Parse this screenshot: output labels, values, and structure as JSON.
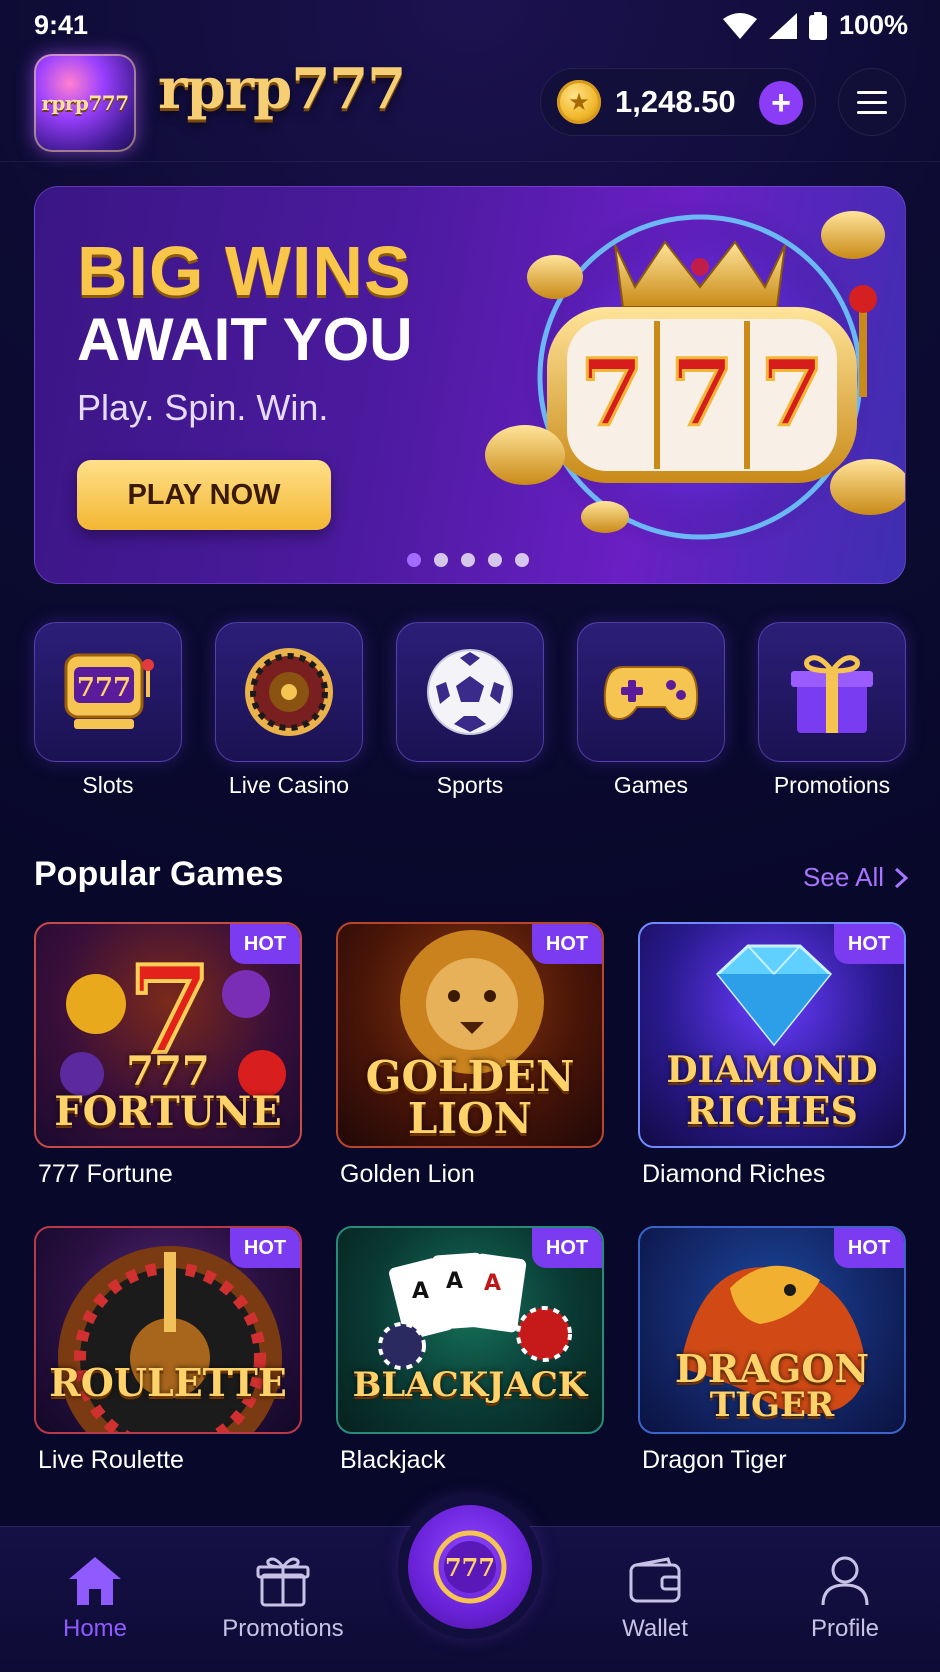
{
  "status_bar": {
    "time": "9:41",
    "battery": "100%"
  },
  "header": {
    "logo_text": "rprp777",
    "brand": "rprp777",
    "balance": "1,248.50",
    "add_label": "+"
  },
  "banner": {
    "title_line1": "BIG WINS",
    "title_line2": "AWAIT YOU",
    "subtitle": "Play. Spin. Win.",
    "cta": "PLAY NOW",
    "slot_digits": "777",
    "active_slide": 1,
    "slide_count": 5
  },
  "categories": [
    {
      "label": "Slots",
      "icon": "slot-machine-icon"
    },
    {
      "label": "Live Casino",
      "icon": "roulette-wheel-icon"
    },
    {
      "label": "Sports",
      "icon": "soccer-ball-icon"
    },
    {
      "label": "Games",
      "icon": "gamepad-icon"
    },
    {
      "label": "Promotions",
      "icon": "gift-icon"
    }
  ],
  "popular": {
    "title": "Popular Games",
    "see_all": "See All",
    "badge": "HOT",
    "games": [
      {
        "name": "777 Fortune",
        "art_line1": "777",
        "art_line2": "FORTUNE"
      },
      {
        "name": "Golden Lion",
        "art_line1": "GOLDEN",
        "art_line2": "LION"
      },
      {
        "name": "Diamond Riches",
        "art_line1": "DIAMOND",
        "art_line2": "RICHES"
      },
      {
        "name": "Live Roulette",
        "art_line1": "ROULETTE",
        "art_line2": ""
      },
      {
        "name": "Blackjack",
        "art_line1": "BLACKJACK",
        "art_line2": ""
      },
      {
        "name": "Dragon Tiger",
        "art_line1": "DRAGON",
        "art_line2": "TIGER"
      }
    ]
  },
  "bottom_nav": {
    "items": [
      {
        "label": "Home",
        "icon": "home-icon",
        "active": true
      },
      {
        "label": "Promotions",
        "icon": "gift-icon"
      },
      {
        "label": "Wallet",
        "icon": "wallet-icon"
      },
      {
        "label": "Profile",
        "icon": "user-icon"
      }
    ],
    "center_label": "777"
  },
  "colors": {
    "accent": "#8b3cf7",
    "gold": "#f8c74a",
    "background": "#0b0a2a"
  }
}
